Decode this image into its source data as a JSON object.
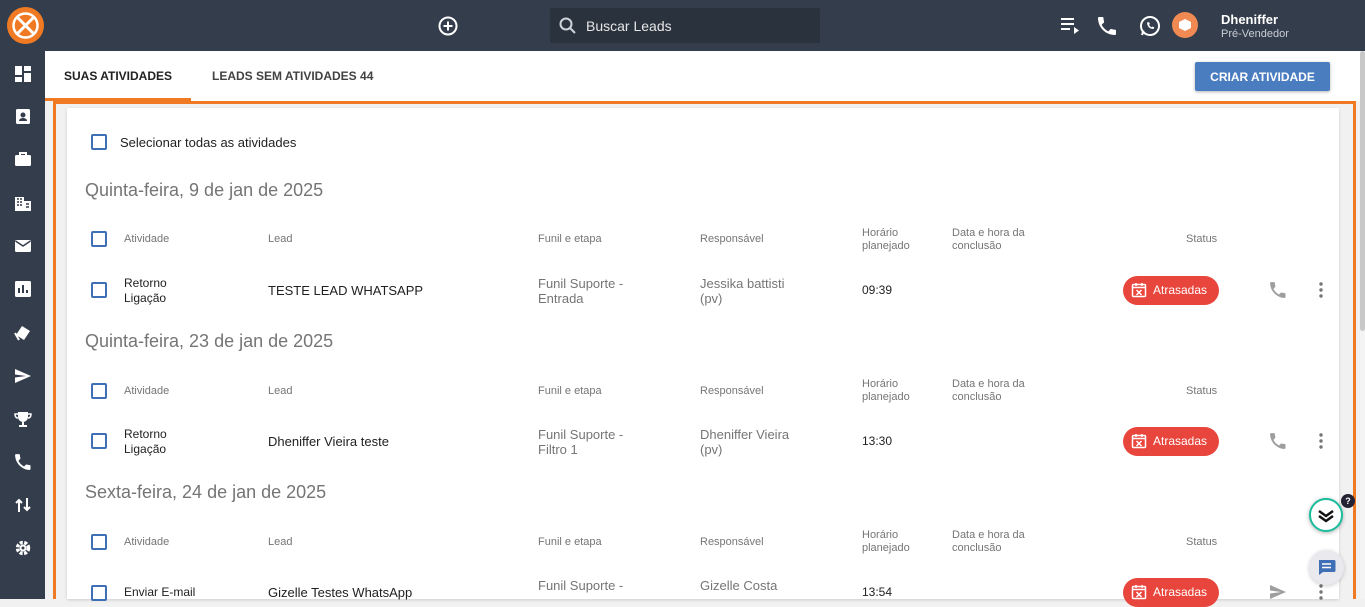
{
  "topbar": {
    "search_placeholder": "Buscar Leads",
    "user_name": "Dheniffer",
    "user_role": "Pré-Vendedor"
  },
  "tabs": [
    {
      "label": "SUAS ATIVIDADES",
      "active": true
    },
    {
      "label": "LEADS SEM ATIVIDADES 44",
      "active": false
    }
  ],
  "create_button": "CRIAR ATIVIDADE",
  "select_all_label": "Selecionar todas as atividades",
  "columns": {
    "activity": "Atividade",
    "lead": "Lead",
    "funnel": "Funil e etapa",
    "owner": "Responsável",
    "planned_1": "Horário",
    "planned_2": "planejado",
    "done_1": "Data e hora da",
    "done_2": "conclusão",
    "status": "Status"
  },
  "groups": [
    {
      "date": "Quinta-feira, 9 de jan de 2025",
      "row": {
        "activity_1": "Retorno",
        "activity_2": "Ligação",
        "lead": "TESTE LEAD WHATSAPP",
        "funnel_1": "Funil Suporte -",
        "funnel_2": "Entrada",
        "owner_1": "Jessika battisti",
        "owner_2": "(pv)",
        "time": "09:39",
        "status": "Atrasadas",
        "action_icon": "phone-icon"
      }
    },
    {
      "date": "Quinta-feira, 23 de jan de 2025",
      "row": {
        "activity_1": "Retorno",
        "activity_2": "Ligação",
        "lead": "Dheniffer Vieira teste",
        "funnel_1": "Funil Suporte -",
        "funnel_2": "Filtro 1",
        "owner_1": "Dheniffer Vieira",
        "owner_2": "(pv)",
        "time": "13:30",
        "status": "Atrasadas",
        "action_icon": "phone-icon"
      }
    },
    {
      "date": "Sexta-feira, 24 de jan de 2025",
      "row": {
        "activity_1": "Enviar E-mail",
        "activity_2": "",
        "lead": "Gizelle Testes WhatsApp",
        "funnel_1": "Funil Suporte -",
        "funnel_2": "",
        "owner_1": "Gizelle Costa",
        "owner_2": "",
        "time": "13:54",
        "status": "Atrasadas",
        "action_icon": "send-icon"
      }
    }
  ],
  "colors": {
    "topbar": "#343d4b",
    "accent_orange": "#f07a23",
    "primary_blue": "#4a7cc0",
    "status_red": "#e8453c"
  }
}
